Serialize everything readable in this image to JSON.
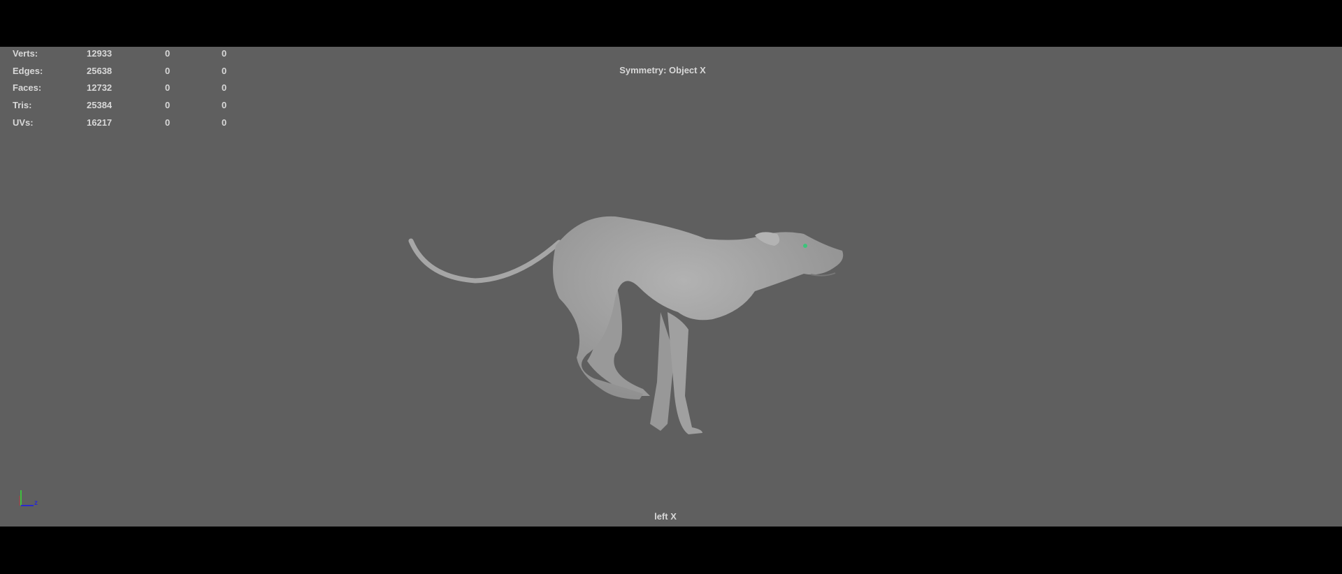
{
  "hud": {
    "stats": [
      {
        "label": "Verts:",
        "values": [
          "12933",
          "0",
          "0"
        ]
      },
      {
        "label": "Edges:",
        "values": [
          "25638",
          "0",
          "0"
        ]
      },
      {
        "label": "Faces:",
        "values": [
          "12732",
          "0",
          "0"
        ]
      },
      {
        "label": "Tris:",
        "values": [
          "25384",
          "0",
          "0"
        ]
      },
      {
        "label": "UVs:",
        "values": [
          "16217",
          "0",
          "0"
        ]
      }
    ],
    "symmetry": "Symmetry: Object X",
    "camera": "left X",
    "axis_label": "z"
  },
  "colors": {
    "viewport": "#5f5f5f",
    "model": "#a2a2a2",
    "hud_text": "#d8d8d8"
  }
}
